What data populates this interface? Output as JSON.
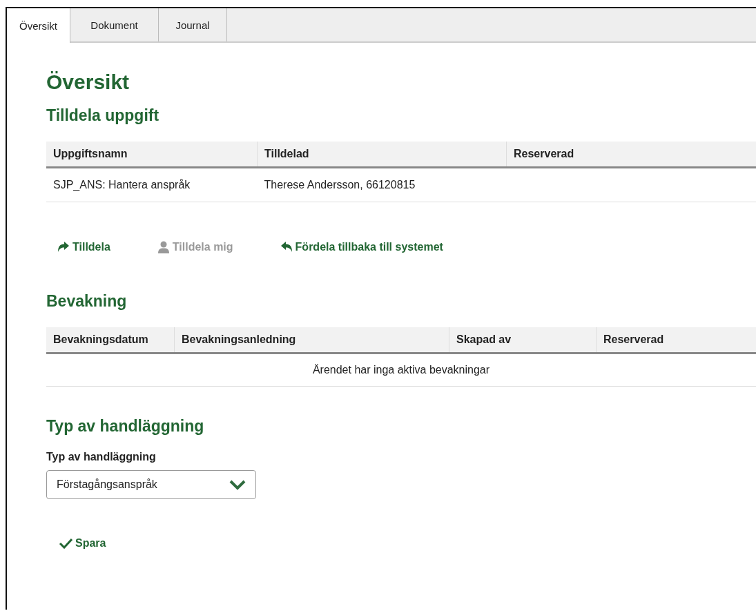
{
  "tabs": [
    {
      "label": "Översikt",
      "selected": true
    },
    {
      "label": "Dokument",
      "selected": false
    },
    {
      "label": "Journal",
      "selected": false
    }
  ],
  "title": "Översikt",
  "task_section": {
    "heading": "Tilldela uppgift",
    "columns": [
      "Uppgiftsnamn",
      "Tilldelad",
      "Reserverad"
    ],
    "rows": [
      [
        "SJP_ANS: Hantera anspråk",
        "Therese Andersson, 66120815",
        ""
      ]
    ]
  },
  "actions": [
    {
      "kind": "forward",
      "label": "Tilldela",
      "disabled": false
    },
    {
      "kind": "person",
      "label": "Tilldela mig",
      "disabled": true
    },
    {
      "kind": "back",
      "label": "Fördela tillbaka till systemet",
      "disabled": false
    }
  ],
  "watch_section": {
    "heading": "Bevakning",
    "columns": [
      "Bevakningsdatum",
      "Bevakningsanledning",
      "Skapad av",
      "Reserverad"
    ],
    "empty_message": "Ärendet har inga aktiva bevakningar"
  },
  "handling_section": {
    "heading": "Typ av handläggning",
    "field_label": "Typ av handläggning",
    "value": "Förstagångsanspråk",
    "save_label": "Spara"
  }
}
